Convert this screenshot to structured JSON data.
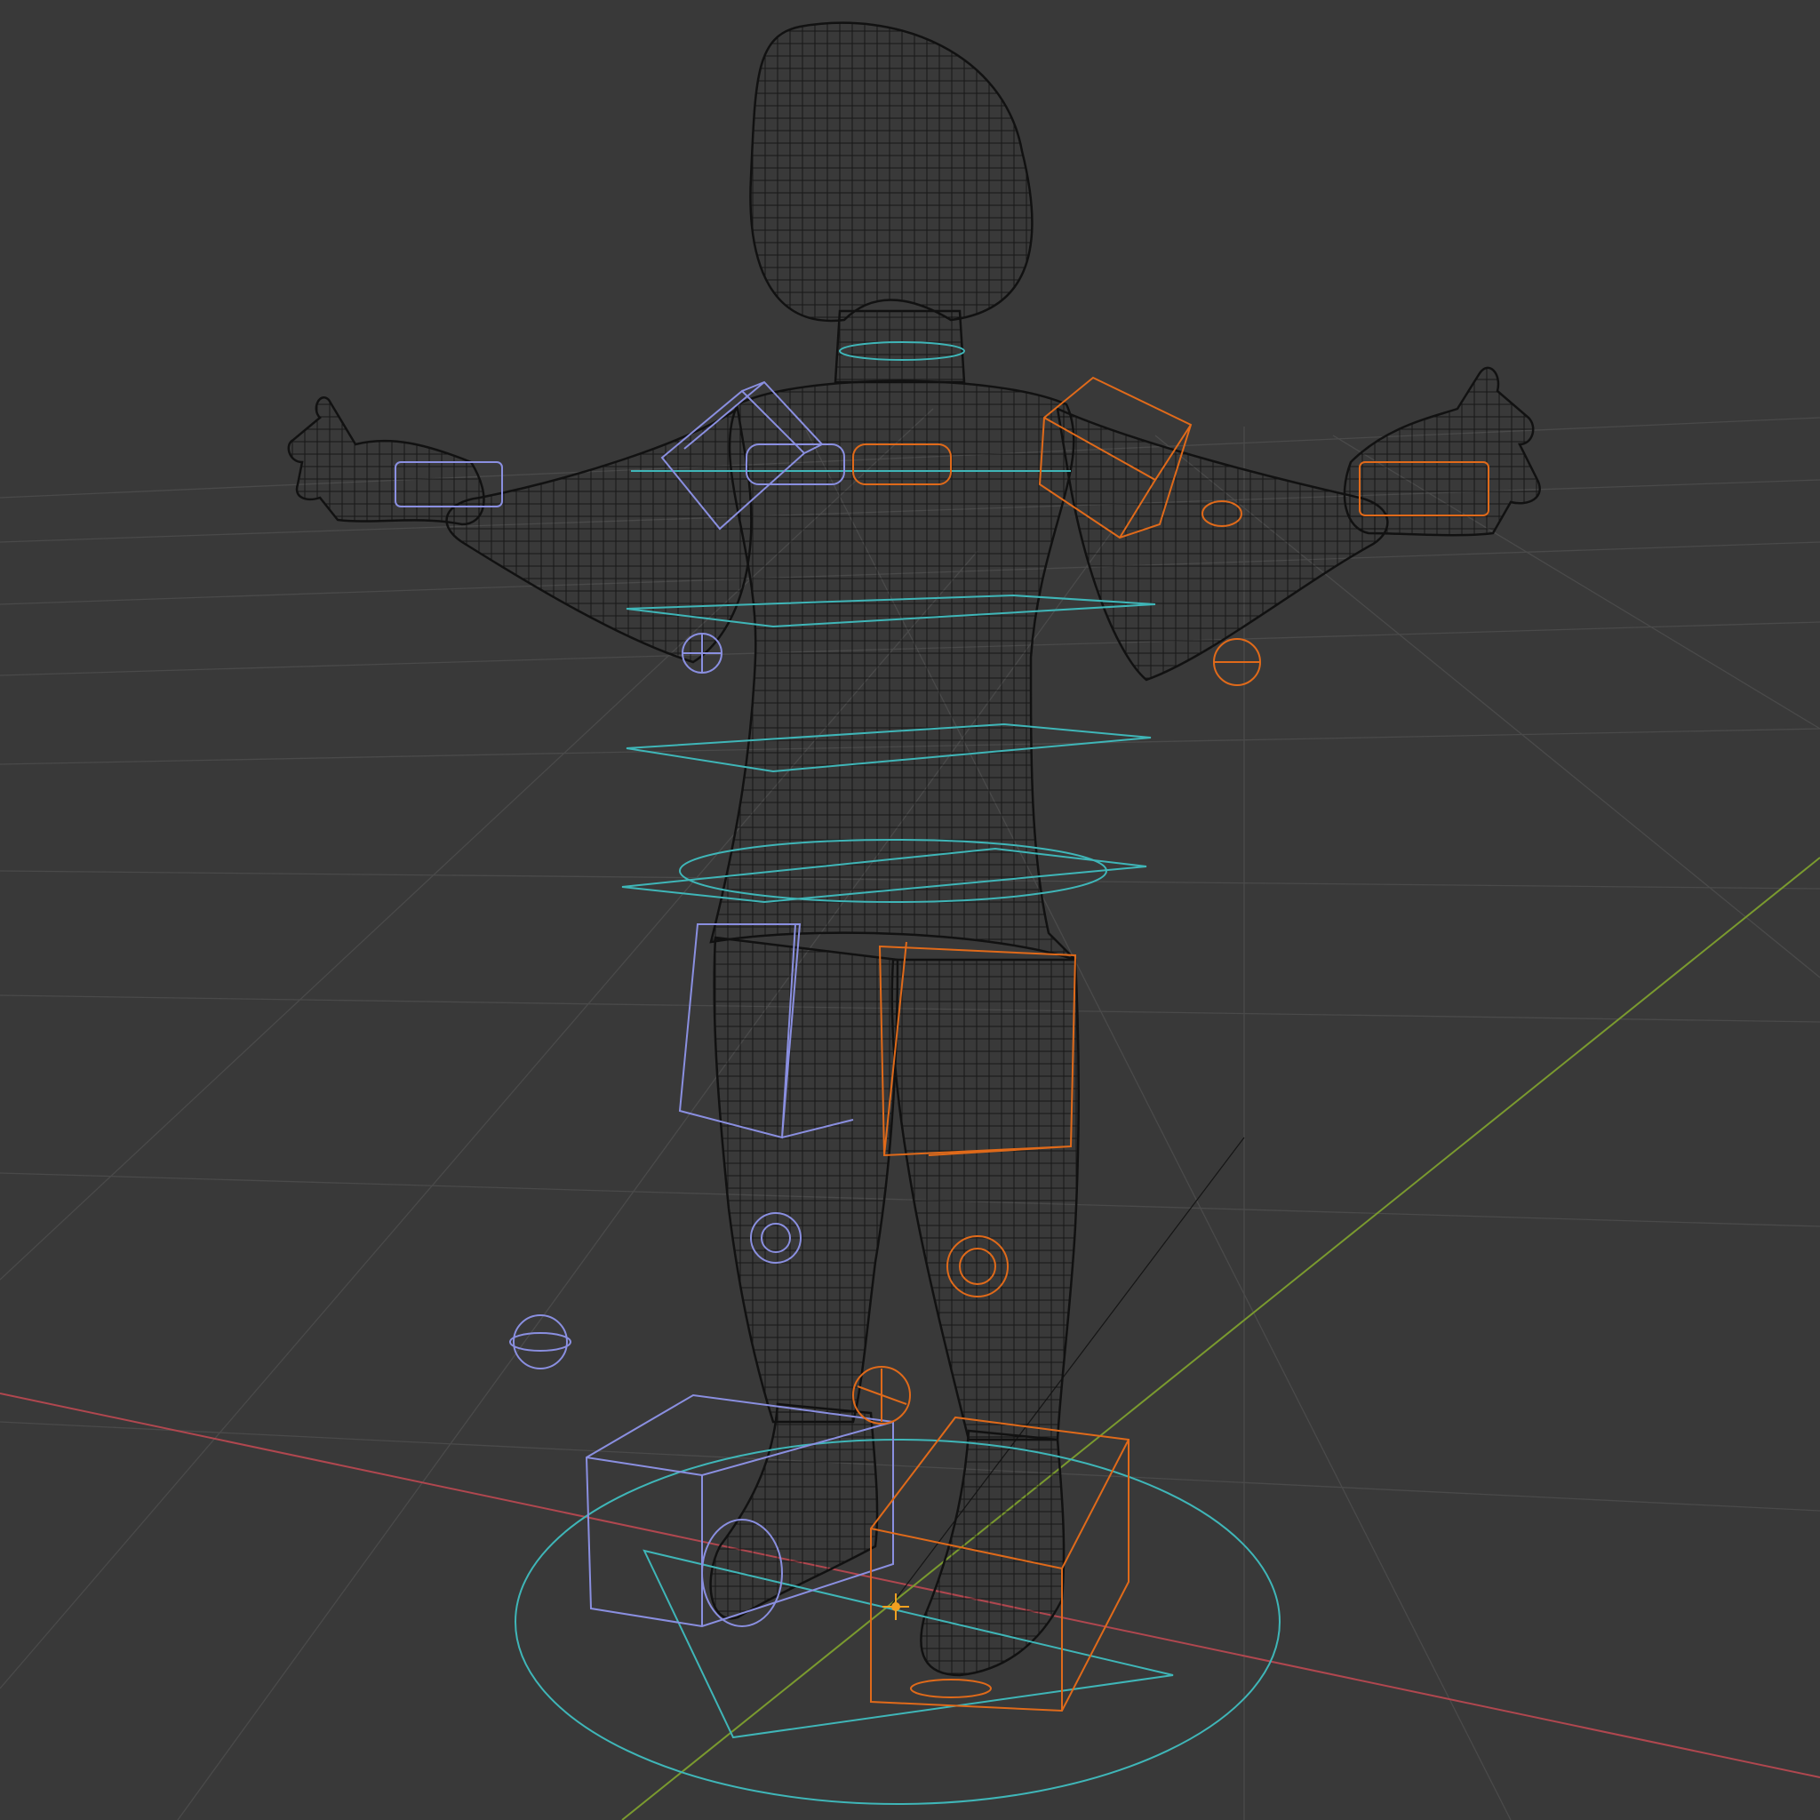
{
  "viewport": {
    "background": "#393939",
    "shading_mode": "wireframe",
    "colors": {
      "grid": "#4a4a4a",
      "x_axis": "#b0474f",
      "y_axis": "#7a9a2f",
      "mesh": "#101010",
      "control_cyan": "#3fb6b8",
      "control_left_blue": "#8a8fe0",
      "control_right_orange": "#e06a1a",
      "origin_marker": "#f0a020"
    }
  },
  "scene": {
    "object": "character-mesh-wireframe",
    "armature_controls": [
      "neck-control",
      "chest-control",
      "spine-control",
      "hips-control",
      "shoulder-left-control",
      "shoulder-right-control",
      "hand-left-control",
      "hand-right-control",
      "thigh-left-control",
      "thigh-right-control",
      "knee-pole-left-control",
      "knee-pole-right-control",
      "foot-left-control",
      "foot-right-control",
      "root-control"
    ]
  }
}
